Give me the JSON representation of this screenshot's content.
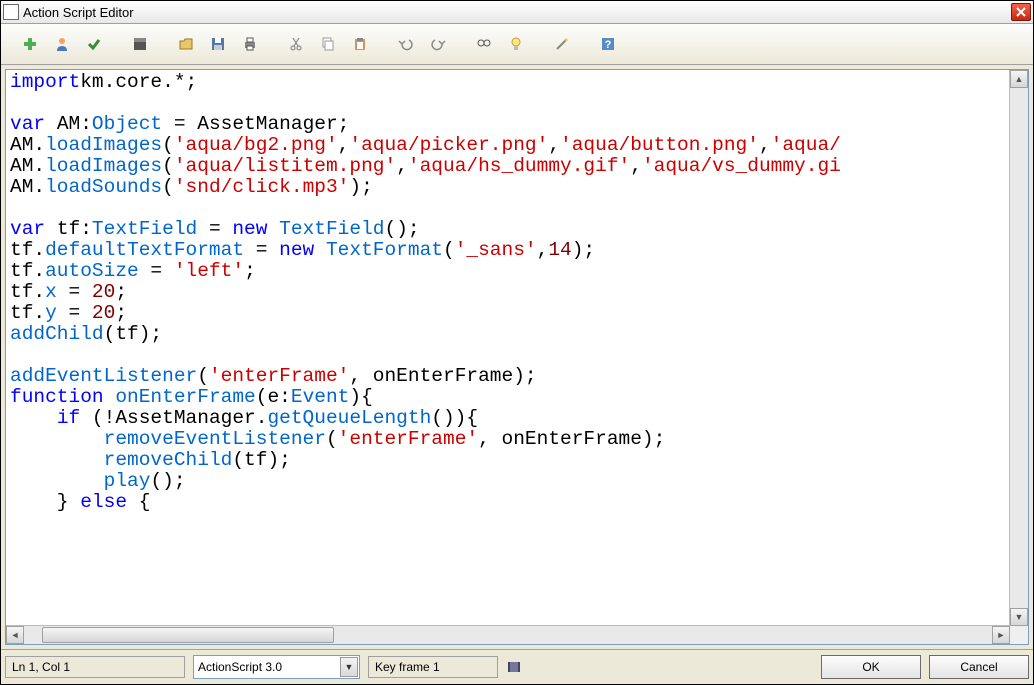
{
  "window": {
    "title": "Action Script Editor"
  },
  "toolbar": {
    "items": [
      "add",
      "user",
      "check",
      "clapper",
      "",
      "open",
      "save",
      "print",
      "",
      "cut",
      "copy",
      "paste",
      "",
      "undo",
      "redo",
      "",
      "find",
      "lightbulb",
      "",
      "wand",
      "",
      "help"
    ]
  },
  "code": {
    "lines": [
      [
        [
          "kw",
          "import"
        ],
        [
          "",
          ""
        ],
        [
          "",
          "km.core.*;"
        ]
      ],
      [
        [
          "",
          ""
        ]
      ],
      [
        [
          "kw",
          "var"
        ],
        [
          "",
          " "
        ],
        [
          "",
          "AM:"
        ],
        [
          "type",
          "Object"
        ],
        [
          "",
          " = AssetManager;"
        ]
      ],
      [
        [
          "",
          "AM."
        ],
        [
          "func",
          "loadImages"
        ],
        [
          "",
          "("
        ],
        [
          "str",
          "'aqua/bg2.png'"
        ],
        [
          "",
          ","
        ],
        [
          "str",
          "'aqua/picker.png'"
        ],
        [
          "",
          ","
        ],
        [
          "str",
          "'aqua/button.png'"
        ],
        [
          "",
          ","
        ],
        [
          "str",
          "'aqua/"
        ]
      ],
      [
        [
          "",
          "AM."
        ],
        [
          "func",
          "loadImages"
        ],
        [
          "",
          "("
        ],
        [
          "str",
          "'aqua/listitem.png'"
        ],
        [
          "",
          ","
        ],
        [
          "str",
          "'aqua/hs_dummy.gif'"
        ],
        [
          "",
          ","
        ],
        [
          "str",
          "'aqua/vs_dummy.gi"
        ]
      ],
      [
        [
          "",
          "AM."
        ],
        [
          "func",
          "loadSounds"
        ],
        [
          "",
          "("
        ],
        [
          "str",
          "'snd/click.mp3'"
        ],
        [
          "",
          ");"
        ]
      ],
      [
        [
          "",
          ""
        ]
      ],
      [
        [
          "kw",
          "var"
        ],
        [
          "",
          " "
        ],
        [
          "",
          "tf:"
        ],
        [
          "type",
          "TextField"
        ],
        [
          "",
          " = "
        ],
        [
          "kw",
          "new"
        ],
        [
          "",
          " "
        ],
        [
          "type",
          "TextField"
        ],
        [
          "",
          "();"
        ]
      ],
      [
        [
          "",
          "tf."
        ],
        [
          "func",
          "defaultTextFormat"
        ],
        [
          "",
          " = "
        ],
        [
          "kw",
          "new"
        ],
        [
          "",
          " "
        ],
        [
          "type",
          "TextFormat"
        ],
        [
          "",
          "("
        ],
        [
          "str",
          "'_sans'"
        ],
        [
          "",
          ","
        ],
        [
          "num",
          "14"
        ],
        [
          "",
          ");"
        ]
      ],
      [
        [
          "",
          "tf."
        ],
        [
          "func",
          "autoSize"
        ],
        [
          "",
          " = "
        ],
        [
          "str",
          "'left'"
        ],
        [
          "",
          ";"
        ]
      ],
      [
        [
          "",
          "tf."
        ],
        [
          "func",
          "x"
        ],
        [
          "",
          " = "
        ],
        [
          "num",
          "20"
        ],
        [
          "",
          ";"
        ]
      ],
      [
        [
          "",
          "tf."
        ],
        [
          "func",
          "y"
        ],
        [
          "",
          " = "
        ],
        [
          "num",
          "20"
        ],
        [
          "",
          ";"
        ]
      ],
      [
        [
          "func",
          "addChild"
        ],
        [
          "",
          "(tf);"
        ]
      ],
      [
        [
          "",
          ""
        ]
      ],
      [
        [
          "func",
          "addEventListener"
        ],
        [
          "",
          "("
        ],
        [
          "str",
          "'enterFrame'"
        ],
        [
          "",
          ", onEnterFrame);"
        ]
      ],
      [
        [
          "kw",
          "function"
        ],
        [
          "",
          " "
        ],
        [
          "func",
          "onEnterFrame"
        ],
        [
          "",
          "(e:"
        ],
        [
          "type",
          "Event"
        ],
        [
          "",
          "){"
        ]
      ],
      [
        [
          "",
          "    "
        ],
        [
          "kw",
          "if"
        ],
        [
          "",
          " (!AssetManager."
        ],
        [
          "func",
          "getQueueLength"
        ],
        [
          "",
          "()){"
        ]
      ],
      [
        [
          "",
          "        "
        ],
        [
          "func",
          "removeEventListener"
        ],
        [
          "",
          "("
        ],
        [
          "str",
          "'enterFrame'"
        ],
        [
          "",
          ", onEnterFrame);"
        ]
      ],
      [
        [
          "",
          "        "
        ],
        [
          "func",
          "removeChild"
        ],
        [
          "",
          "(tf);"
        ]
      ],
      [
        [
          "",
          "        "
        ],
        [
          "func",
          "play"
        ],
        [
          "",
          "();"
        ]
      ],
      [
        [
          "",
          "    } "
        ],
        [
          "kw",
          "else"
        ],
        [
          "",
          " {"
        ]
      ]
    ]
  },
  "status": {
    "position": "Ln 1, Col 1",
    "language": "ActionScript 3.0",
    "keyframe": "Key frame 1"
  },
  "buttons": {
    "ok": "OK",
    "cancel": "Cancel"
  }
}
